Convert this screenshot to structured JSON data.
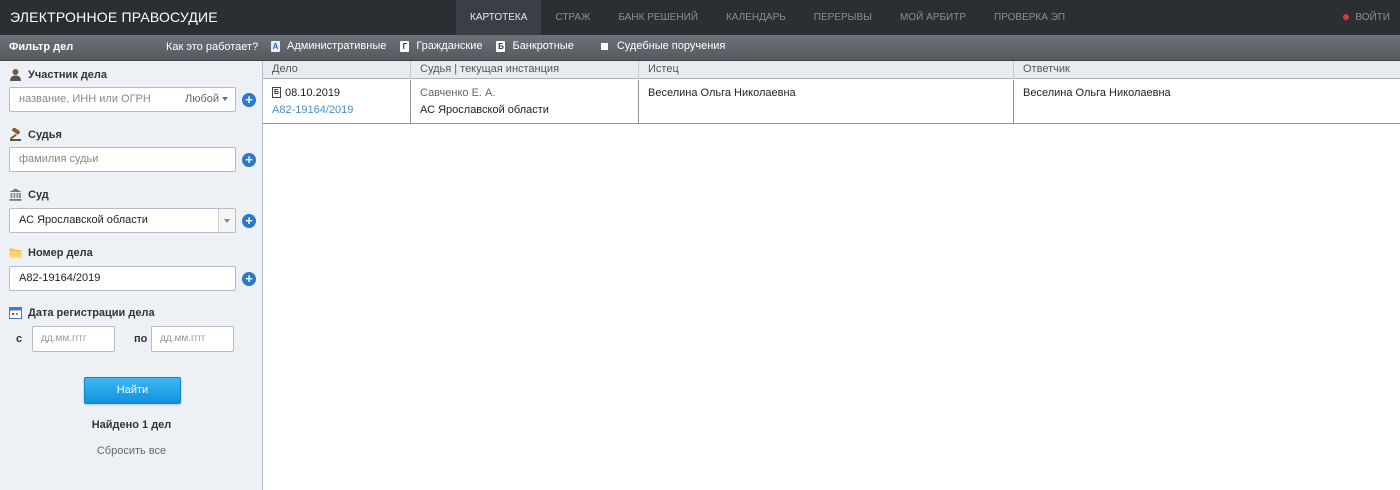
{
  "header": {
    "brand": "ЭЛЕКТРОННОЕ ПРАВОСУДИЕ",
    "nav": [
      "КАРТОТЕКА",
      "СТРАЖ",
      "БАНК РЕШЕНИЙ",
      "КАЛЕНДАРЬ",
      "ПЕРЕРЫВЫ",
      "МОЙ АРБИТР",
      "ПРОВЕРКА ЭП"
    ],
    "active_tab": "КАРТОТЕКА",
    "logout": "ВОЙТИ"
  },
  "filterbar": {
    "title": "Фильтр дел",
    "howto": "Как это работает?",
    "types": [
      {
        "icon": "А",
        "label": "Административные"
      },
      {
        "icon": "Г",
        "label": "Гражданские"
      },
      {
        "icon": "Б",
        "label": "Банкротные"
      }
    ],
    "orders_label": "Судебные поручения"
  },
  "sidebar": {
    "participant_label": "Участник дела",
    "participant_placeholder": "название, ИНН или ОГРН",
    "participant_role": "Любой",
    "judge_label": "Судья",
    "judge_placeholder": "фамилия судьи",
    "court_label": "Суд",
    "court_value": "АС Ярославской области",
    "case_number_label": "Номер дела",
    "case_number_value": "А82-19164/2019",
    "date_label": "Дата регистрации дела",
    "date_from_label": "с",
    "date_from_placeholder": "дд.мм.гггг",
    "date_to_label": "по",
    "date_to_placeholder": "дд.мм.гггг",
    "find_button": "Найти",
    "found_text": "Найдено 1 дел",
    "reset_text": "Сбросить все"
  },
  "table": {
    "headers": [
      "Дело",
      "Судья | текущая инстанция",
      "Истец",
      "Ответчик"
    ],
    "rows": [
      {
        "type_icon": "Б",
        "date": "08.10.2019",
        "number": "А82-19164/2019",
        "judge": "Савченко Е. А.",
        "court": "АС Ярославской области",
        "plaintiff": "Веселина Ольга Николаевна",
        "defendant": "Веселина Ольга Николаевна"
      }
    ]
  },
  "colors": {
    "topbar": "#2b2e33",
    "accent_blue": "#2d79c7",
    "link": "#4b8fc7",
    "find_button": "#1e9fe8"
  }
}
